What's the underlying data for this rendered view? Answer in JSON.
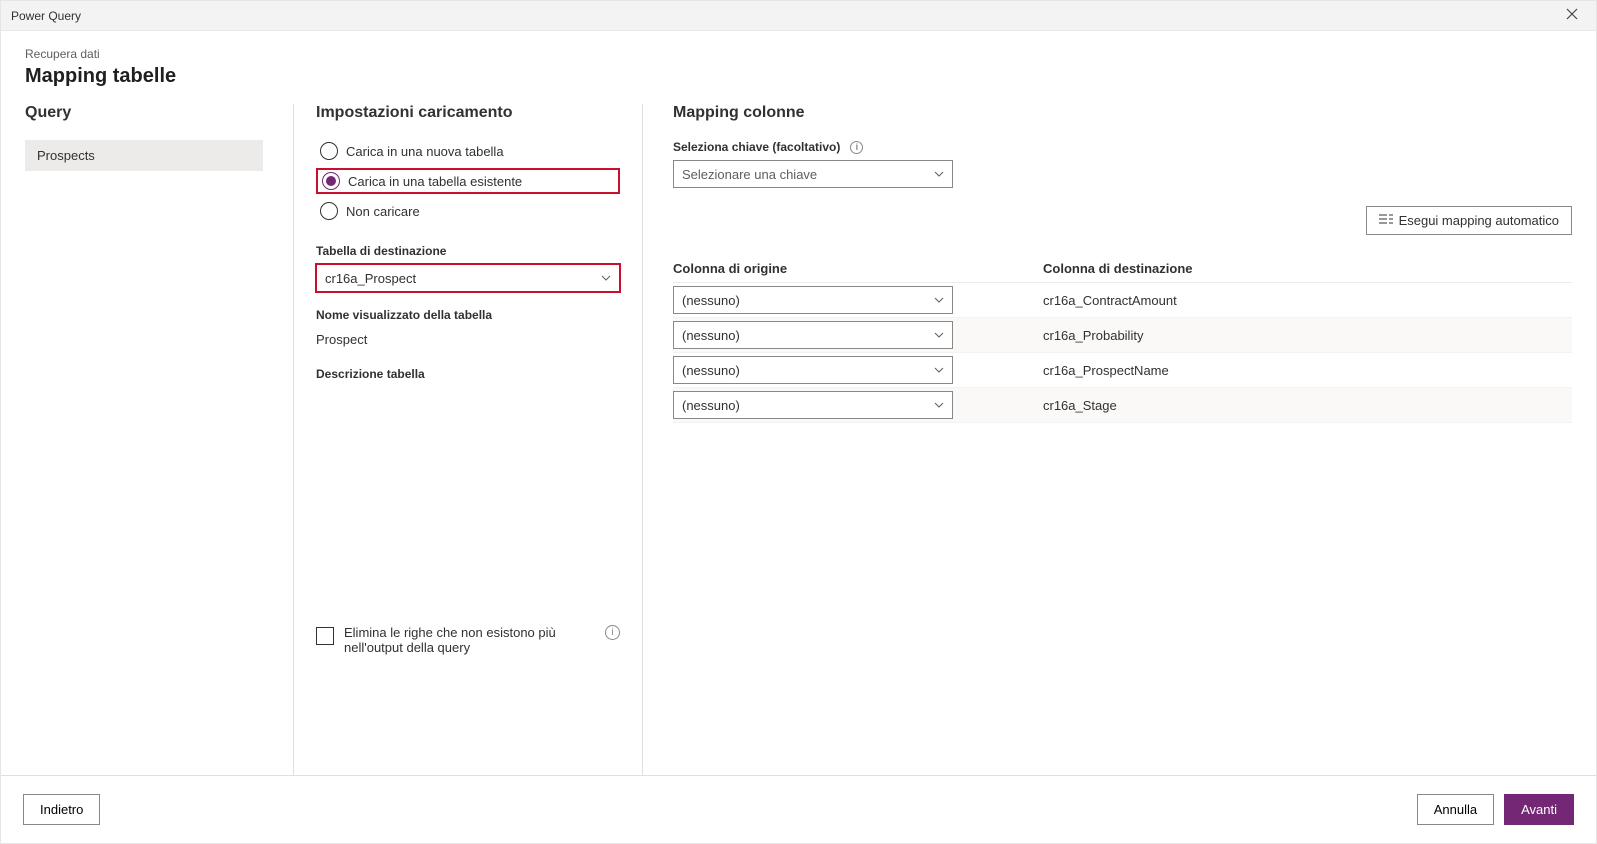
{
  "titlebar": {
    "title": "Power Query"
  },
  "header": {
    "breadcrumb": "Recupera dati",
    "page_title": "Mapping tabelle"
  },
  "query_panel": {
    "title": "Query",
    "items": [
      "Prospects"
    ]
  },
  "settings_panel": {
    "title": "Impostazioni caricamento",
    "radio_new": "Carica in una nuova tabella",
    "radio_existing": "Carica in una tabella esistente",
    "radio_none": "Non caricare",
    "dest_table_label": "Tabella di destinazione",
    "dest_table_value": "cr16a_Prospect",
    "display_name_label": "Nome visualizzato della tabella",
    "display_name_value": "Prospect",
    "description_label": "Descrizione tabella",
    "delete_rows_label": "Elimina le righe che non esistono più nell'output della query"
  },
  "mapping_panel": {
    "title": "Mapping colonne",
    "key_label": "Seleziona chiave (facoltativo)",
    "key_placeholder": "Selezionare una chiave",
    "auto_map_label": "Esegui mapping automatico",
    "col_src": "Colonna di origine",
    "col_dest": "Colonna di destinazione",
    "none_label": "(nessuno)",
    "rows": [
      {
        "src": "(nessuno)",
        "dest": "cr16a_ContractAmount"
      },
      {
        "src": "(nessuno)",
        "dest": "cr16a_Probability"
      },
      {
        "src": "(nessuno)",
        "dest": "cr16a_ProspectName"
      },
      {
        "src": "(nessuno)",
        "dest": "cr16a_Stage"
      }
    ]
  },
  "footer": {
    "back": "Indietro",
    "cancel": "Annulla",
    "next": "Avanti"
  }
}
